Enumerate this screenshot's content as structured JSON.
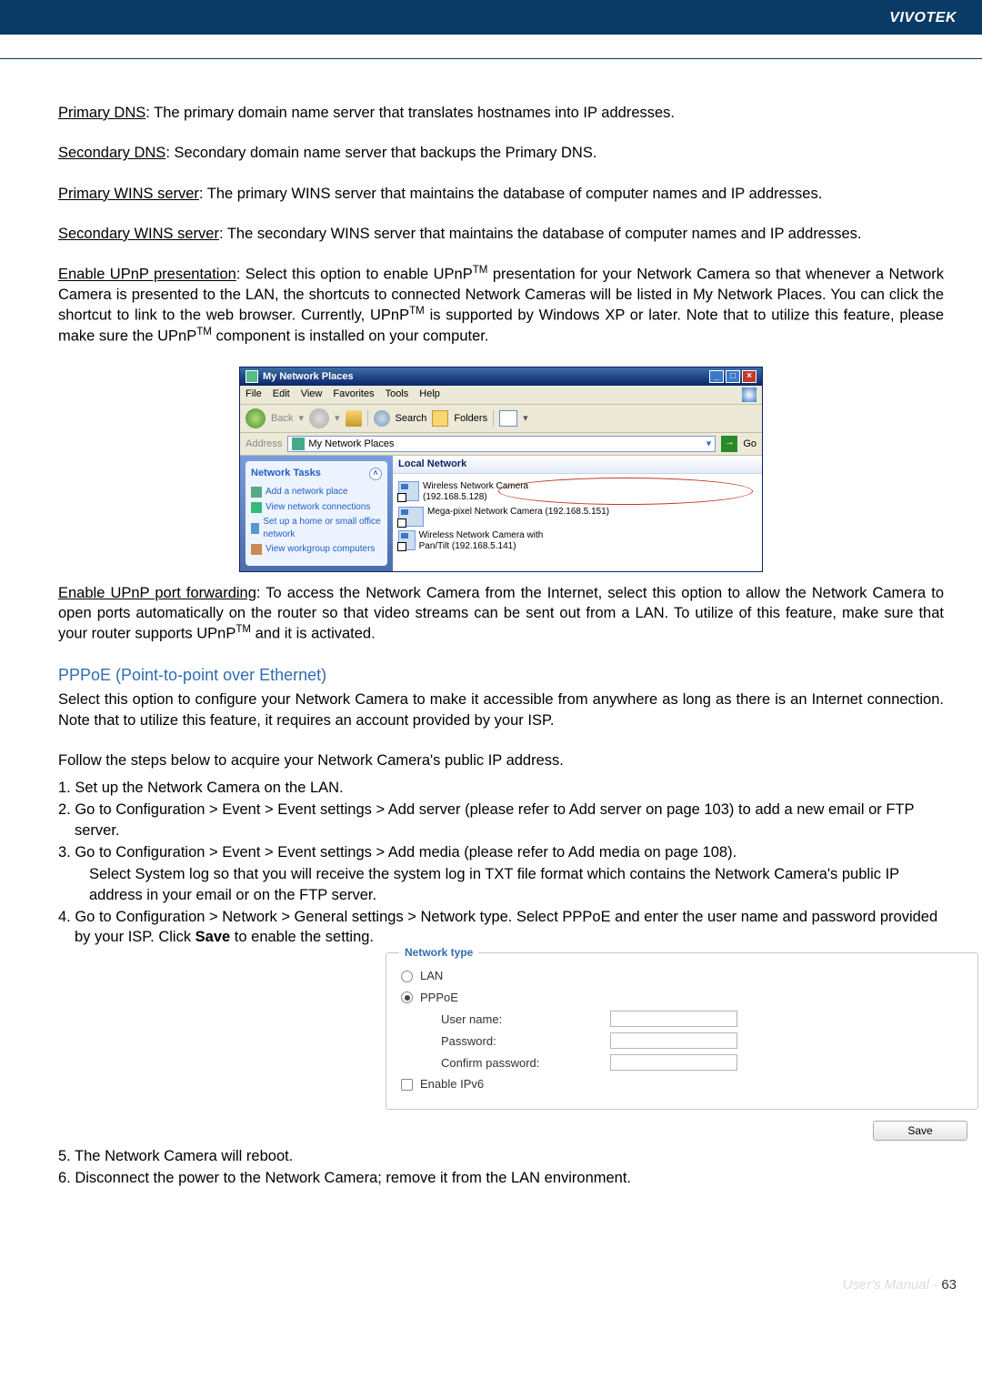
{
  "brand": "VIVOTEK",
  "footer_label": "User's Manual - ",
  "footer_page": "63",
  "defs": {
    "primary_dns": {
      "term": "Primary DNS",
      "text": ": The primary domain name server that translates hostnames into IP addresses."
    },
    "secondary_dns": {
      "term": "Secondary DNS",
      "text": ": Secondary domain name server that backups the Primary DNS."
    },
    "primary_wins": {
      "term": "Primary WINS server",
      "text": ": The primary WINS server that maintains the database of computer names and IP addresses."
    },
    "secondary_wins": {
      "term": "Secondary WINS server",
      "text": ": The secondary WINS server that maintains the database of computer names and IP addresses."
    },
    "upnp_present": {
      "term": "Enable UPnP presentation",
      "text_a": ": Select this option to enable UPnP",
      "tm1": "TM",
      "text_b": " presentation for your Network Camera so that whenever a Network Camera is presented to the LAN, the shortcuts to connected Network Cameras will be listed in My Network Places. You can click the shortcut to link to the web browser. Currently, UPnP",
      "tm2": "TM",
      "text_c": " is supported by Windows XP or later. Note that to utilize this feature, please make sure the UPnP",
      "tm3": "TM",
      "text_d": " component is installed on your computer."
    },
    "upnp_port": {
      "term": "Enable UPnP port forwarding",
      "text_a": ": To access the Network Camera from the Internet, select this option to allow the Network Camera to open ports automatically on the router so that video streams can be sent out from a LAN. To utilize of this feature, make sure that your router supports UPnP",
      "tm": "TM",
      "text_b": " and it is activated."
    }
  },
  "pppoe": {
    "heading": "PPPoE (Point-to-point over Ethernet)",
    "intro": "Select this option to configure your Network Camera to make it accessible from anywhere as long as there is an Internet connection. Note that to utilize this feature, it requires an account provided by your ISP.",
    "follow": "Follow the steps below to acquire your Network Camera's public IP address.",
    "step1": "1. Set up the Network Camera on the LAN.",
    "step2": "2. Go to Configuration > Event > Event settings > Add server (please refer to Add server on page 103) to add a new email or FTP server.",
    "step3": "3. Go to Configuration > Event > Event settings > Add media (please refer to Add media on page 108).",
    "step3b": "Select System log so that you will receive the system log in TXT file format which contains the Network Camera's public IP address in your email or on the FTP server.",
    "step4a": "4. Go to Configuration > Network > General settings > Network type. Select PPPoE and enter the user name and password provided by your ISP. Click ",
    "step4bold": "Save",
    "step4b": " to enable the setting.",
    "step5": "5. The Network Camera will reboot.",
    "step6": "6. Disconnect the power to the Network Camera; remove it from the LAN environment."
  },
  "window": {
    "title": "My Network Places",
    "menu": {
      "file": "File",
      "edit": "Edit",
      "view": "View",
      "favorites": "Favorites",
      "tools": "Tools",
      "help": "Help"
    },
    "toolbar": {
      "back": "Back",
      "search": "Search",
      "folders": "Folders"
    },
    "address_label": "Address",
    "address_value": "My Network Places",
    "go": "Go",
    "side_title": "Network Tasks",
    "side_links": {
      "a": "Add a network place",
      "b": "View network connections",
      "c": "Set up a home or small office network",
      "d": "View workgroup computers"
    },
    "local_header": "Local Network",
    "items": {
      "a": "Wireless Network Camera (192.168.5.128)",
      "b": "Mega-pixel Network Camera (192.168.5.151)",
      "c": "Wireless Network Camera with Pan/Tilt (192.168.5.141)"
    }
  },
  "network_type": {
    "legend": "Network type",
    "lan": "LAN",
    "pppoe": "PPPoE",
    "user": "User name:",
    "pass": "Password:",
    "confirm": "Confirm password:",
    "ipv6": "Enable IPv6",
    "save": "Save"
  }
}
